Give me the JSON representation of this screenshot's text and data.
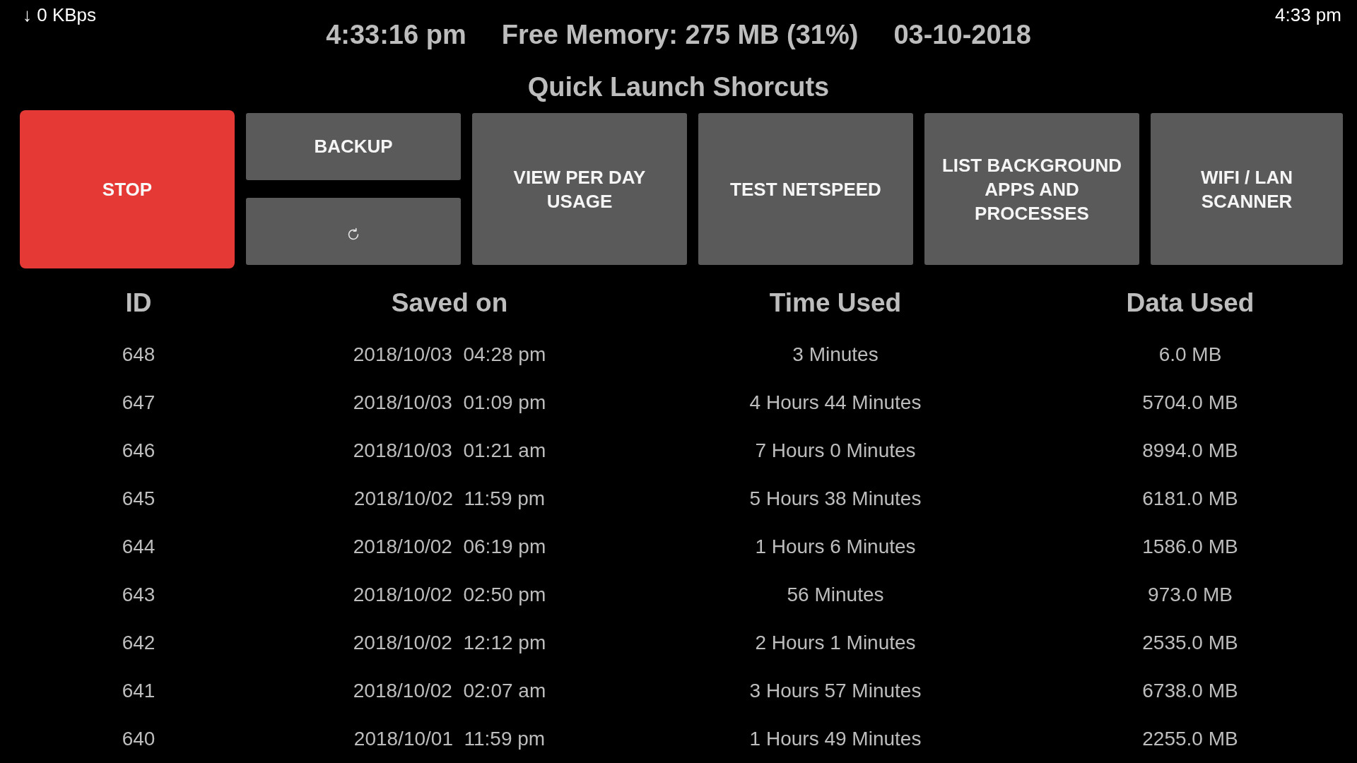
{
  "status_bar": {
    "net_speed": "↓ 0 KBps",
    "clock": "4:33 pm"
  },
  "header": {
    "time": "4:33:16 pm",
    "free_memory": "Free Memory: 275 MB (31%)",
    "date": "03-10-2018"
  },
  "shortcuts": {
    "title": "Quick Launch Shorcuts",
    "buttons": [
      {
        "kind": "danger",
        "label": "STOP"
      },
      {
        "kind": "stack",
        "buttons": [
          {
            "kind": "text",
            "label": "BACKUP"
          },
          {
            "kind": "icon"
          }
        ]
      },
      {
        "kind": "text",
        "label": "VIEW PER DAY USAGE"
      },
      {
        "kind": "text",
        "label": "TEST NETSPEED"
      },
      {
        "kind": "text",
        "label": "LIST BACKGROUND APPS AND PROCESSES"
      },
      {
        "kind": "text",
        "label": "WIFI / LAN SCANNER"
      }
    ]
  },
  "table": {
    "columns": [
      "ID",
      "Saved on",
      "Time Used",
      "Data Used"
    ],
    "rows": [
      [
        "648",
        "2018/10/03  04:28 pm",
        "3 Minutes",
        "6.0 MB"
      ],
      [
        "647",
        "2018/10/03  01:09 pm",
        "4 Hours 44 Minutes",
        "5704.0 MB"
      ],
      [
        "646",
        "2018/10/03  01:21 am",
        "7 Hours 0 Minutes",
        "8994.0 MB"
      ],
      [
        "645",
        "2018/10/02  11:59 pm",
        "5 Hours 38 Minutes",
        "6181.0 MB"
      ],
      [
        "644",
        "2018/10/02  06:19 pm",
        "1 Hours 6 Minutes",
        "1586.0 MB"
      ],
      [
        "643",
        "2018/10/02  02:50 pm",
        "56 Minutes",
        "973.0 MB"
      ],
      [
        "642",
        "2018/10/02  12:12 pm",
        "2 Hours 1 Minutes",
        "2535.0 MB"
      ],
      [
        "641",
        "2018/10/02  02:07 am",
        "3 Hours 57 Minutes",
        "6738.0 MB"
      ],
      [
        "640",
        "2018/10/01  11:59 pm",
        "1 Hours 49 Minutes",
        "2255.0 MB"
      ]
    ]
  }
}
